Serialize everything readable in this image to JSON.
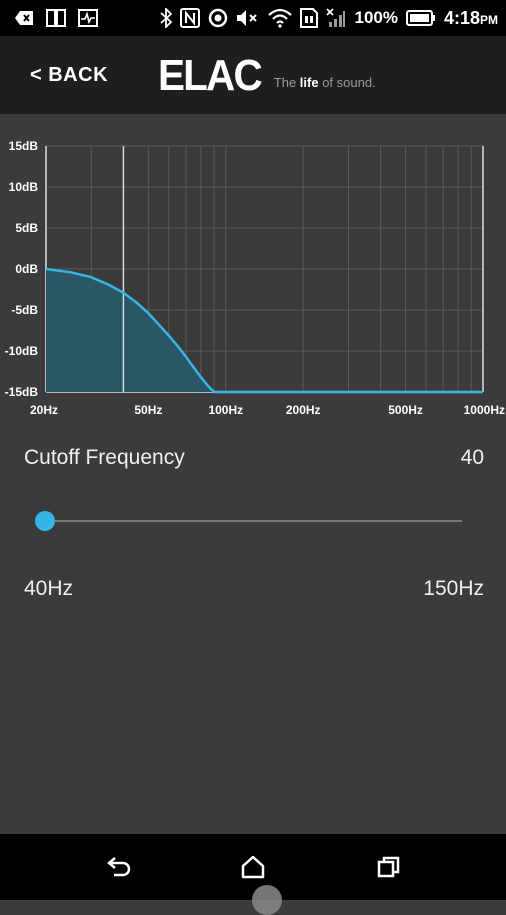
{
  "status_bar": {
    "battery_percent": "100%",
    "time": "4:18",
    "ampm": "PM",
    "icons": [
      "back-arrow-notification-icon",
      "tablet-icon",
      "pulse-icon",
      "bluetooth-icon",
      "nfc-icon",
      "do-not-disturb-icon",
      "mute-icon",
      "wifi-icon",
      "storage-icon",
      "no-signal-icon",
      "battery-icon"
    ]
  },
  "header": {
    "back_label": "< BACK",
    "brand_mark": "ELAC",
    "tagline_pre": "The ",
    "tagline_strong": "life",
    "tagline_post": " of sound."
  },
  "chart_data": {
    "type": "area",
    "x_scale": "log",
    "xlabel": "",
    "ylabel": "",
    "x_tick_labels": [
      "20Hz",
      "50Hz",
      "100Hz",
      "200Hz",
      "500Hz",
      "1000Hz"
    ],
    "x_ticks": [
      20,
      50,
      100,
      200,
      500,
      1000
    ],
    "y_tick_labels": [
      "15dB",
      "10dB",
      "5dB",
      "0dB",
      "-5dB",
      "-10dB",
      "-15dB"
    ],
    "y_ticks": [
      15,
      10,
      5,
      0,
      -5,
      -10,
      -15
    ],
    "xlim": [
      20,
      1000
    ],
    "ylim": [
      -15,
      15
    ],
    "grid": true,
    "cutoff_marker_hz": 40,
    "series": [
      {
        "x": [
          20,
          25,
          30,
          35,
          40,
          45,
          50,
          55,
          60,
          65,
          70,
          75,
          80,
          85,
          90,
          95,
          100,
          200,
          500,
          1000
        ],
        "values": [
          0,
          -0.4,
          -1,
          -1.9,
          -2.9,
          -4.1,
          -5.4,
          -6.8,
          -8.1,
          -9.4,
          -10.7,
          -12,
          -13.2,
          -14.2,
          -15,
          -15,
          -15,
          -15,
          -15,
          -15
        ]
      }
    ],
    "colors": {
      "line": "#35b6e6",
      "fill": "#2b5666",
      "grid": "#5a5a5a",
      "marker": "#d8d8d8"
    }
  },
  "controls": {
    "cutoff_label": "Cutoff Frequency",
    "cutoff_value": "40",
    "slider_value_fraction": 0,
    "min_label": "40Hz",
    "max_label": "150Hz"
  },
  "nav_bar": {
    "icons": [
      "back-icon",
      "home-icon",
      "recents-icon"
    ]
  }
}
